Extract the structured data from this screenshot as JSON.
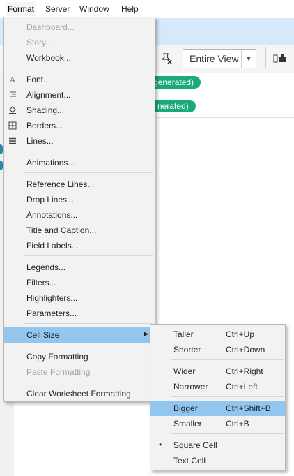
{
  "menubar": {
    "items": [
      "Format",
      "Server",
      "Window",
      "Help"
    ]
  },
  "toolbar": {
    "view_selector": "Entire View"
  },
  "shelves": {
    "pill1": "generated)",
    "pill2": "nerated)"
  },
  "format_menu": {
    "items": [
      {
        "label": "Dashboard...",
        "disabled": true
      },
      {
        "label": "Story...",
        "disabled": true
      },
      {
        "label": "Workbook..."
      },
      {
        "label": "Font...",
        "icon": "font-icon"
      },
      {
        "label": "Alignment...",
        "icon": "alignment-icon"
      },
      {
        "label": "Shading...",
        "icon": "shading-icon"
      },
      {
        "label": "Borders...",
        "icon": "borders-icon"
      },
      {
        "label": "Lines...",
        "icon": "lines-icon"
      },
      {
        "label": "Animations..."
      },
      {
        "label": "Reference Lines..."
      },
      {
        "label": "Drop Lines..."
      },
      {
        "label": "Annotations..."
      },
      {
        "label": "Title and Caption..."
      },
      {
        "label": "Field Labels..."
      },
      {
        "label": "Legends..."
      },
      {
        "label": "Filters..."
      },
      {
        "label": "Highlighters..."
      },
      {
        "label": "Parameters..."
      },
      {
        "label": "Cell Size",
        "highlighted": true,
        "submenu": true
      },
      {
        "label": "Copy Formatting"
      },
      {
        "label": "Paste Formatting",
        "disabled": true
      },
      {
        "label": "Clear Worksheet Formatting"
      }
    ]
  },
  "cell_size_menu": {
    "items": [
      {
        "label": "Taller",
        "shortcut": "Ctrl+Up"
      },
      {
        "label": "Shorter",
        "shortcut": "Ctrl+Down"
      },
      {
        "label": "Wider",
        "shortcut": "Ctrl+Right"
      },
      {
        "label": "Narrower",
        "shortcut": "Ctrl+Left"
      },
      {
        "label": "Bigger",
        "shortcut": "Ctrl+Shift+B",
        "highlighted": true
      },
      {
        "label": "Smaller",
        "shortcut": "Ctrl+B"
      },
      {
        "label": "Square Cell",
        "checked": true,
        "bullet": "•"
      },
      {
        "label": "Text Cell"
      }
    ]
  }
}
